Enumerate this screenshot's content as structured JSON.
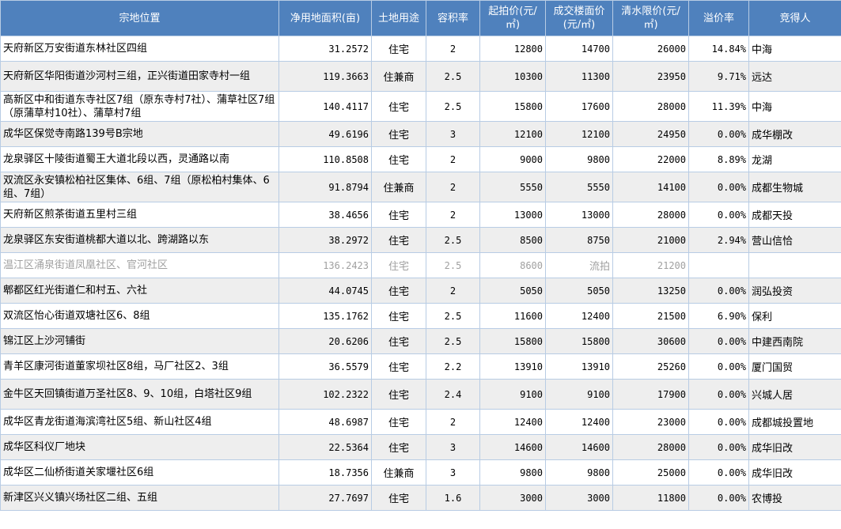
{
  "columns": [
    "宗地位置",
    "净用地面积(亩)",
    "土地用途",
    "容积率",
    "起拍价(元/㎡)",
    "成交楼面价(元/㎡)",
    "清水限价(元/㎡)",
    "溢价率",
    "竞得人"
  ],
  "rows": [
    {
      "location": "天府新区万安街道东林社区四组",
      "area": "31.2572",
      "use": "住宅",
      "far": "2",
      "start": "12800",
      "deal": "14700",
      "limit": "26000",
      "premium": "14.84%",
      "winner": "中海"
    },
    {
      "location": "天府新区华阳街道沙河村三组，正兴街道田家寺村一组",
      "area": "119.3663",
      "use": "住兼商",
      "far": "2.5",
      "start": "10300",
      "deal": "11300",
      "limit": "23950",
      "premium": "9.71%",
      "winner": "远达"
    },
    {
      "location": "高新区中和街道东寺社区7组（原东寺村7社）、蒲草社区7组（原蒲草村10社）、蒲草村7组",
      "area": "140.4117",
      "use": "住宅",
      "far": "2.5",
      "start": "15800",
      "deal": "17600",
      "limit": "28000",
      "premium": "11.39%",
      "winner": "中海"
    },
    {
      "location": "成华区保觉寺南路139号B宗地",
      "area": "49.6196",
      "use": "住宅",
      "far": "3",
      "start": "12100",
      "deal": "12100",
      "limit": "24950",
      "premium": "0.00%",
      "winner": "成华棚改"
    },
    {
      "location": "龙泉驿区十陵街道蜀王大道北段以西，灵通路以南",
      "area": "110.8508",
      "use": "住宅",
      "far": "2",
      "start": "9000",
      "deal": "9800",
      "limit": "22000",
      "premium": "8.89%",
      "winner": "龙湖"
    },
    {
      "location": "双流区永安镇松柏社区集体、6组、7组（原松柏村集体、6组、7组）",
      "area": "91.8794",
      "use": "住兼商",
      "far": "2",
      "start": "5550",
      "deal": "5550",
      "limit": "14100",
      "premium": "0.00%",
      "winner": "成都生物城"
    },
    {
      "location": "天府新区煎茶街道五里村三组",
      "area": "38.4656",
      "use": "住宅",
      "far": "2",
      "start": "13000",
      "deal": "13000",
      "limit": "28000",
      "premium": "0.00%",
      "winner": "成都天投"
    },
    {
      "location": "龙泉驿区东安街道桃都大道以北、跨湖路以东",
      "area": "38.2972",
      "use": "住宅",
      "far": "2.5",
      "start": "8500",
      "deal": "8750",
      "limit": "21000",
      "premium": "2.94%",
      "winner": "营山信恰"
    },
    {
      "location": "温江区涌泉街道凤凰社区、官河社区",
      "area": "136.2423",
      "use": "住宅",
      "far": "2.5",
      "start": "8600",
      "deal": "流拍",
      "limit": "21200",
      "premium": "",
      "winner": ""
    },
    {
      "location": "郫都区红光街道仁和村五、六社",
      "area": "44.0745",
      "use": "住宅",
      "far": "2",
      "start": "5050",
      "deal": "5050",
      "limit": "13250",
      "premium": "0.00%",
      "winner": "润弘投资"
    },
    {
      "location": "双流区怡心街道双塘社区6、8组",
      "area": "135.1762",
      "use": "住宅",
      "far": "2.5",
      "start": "11600",
      "deal": "12400",
      "limit": "21500",
      "premium": "6.90%",
      "winner": "保利"
    },
    {
      "location": "锦江区上沙河铺街",
      "area": "20.6206",
      "use": "住宅",
      "far": "2.5",
      "start": "15800",
      "deal": "15800",
      "limit": "30600",
      "premium": "0.00%",
      "winner": "中建西南院"
    },
    {
      "location": "青羊区康河街道董家坝社区8组，马厂社区2、3组",
      "area": "36.5579",
      "use": "住宅",
      "far": "2.2",
      "start": "13910",
      "deal": "13910",
      "limit": "25260",
      "premium": "0.00%",
      "winner": "厦门国贸"
    },
    {
      "location": "金牛区天回镇街道万圣社区8、9、10组，白塔社区9组",
      "area": "102.2322",
      "use": "住宅",
      "far": "2.4",
      "start": "9100",
      "deal": "9100",
      "limit": "17900",
      "premium": "0.00%",
      "winner": "兴城人居"
    },
    {
      "location": "成华区青龙街道海滨湾社区5组、新山社区4组",
      "area": "48.6987",
      "use": "住宅",
      "far": "2",
      "start": "12400",
      "deal": "12400",
      "limit": "23000",
      "premium": "0.00%",
      "winner": "成都城投置地"
    },
    {
      "location": "成华区科仪厂地块",
      "area": "22.5364",
      "use": "住宅",
      "far": "3",
      "start": "14600",
      "deal": "14600",
      "limit": "28000",
      "premium": "0.00%",
      "winner": "成华旧改"
    },
    {
      "location": "成华区二仙桥街道关家堰社区6组",
      "area": "18.7356",
      "use": "住兼商",
      "far": "3",
      "start": "9800",
      "deal": "9800",
      "limit": "25000",
      "premium": "0.00%",
      "winner": "成华旧改"
    },
    {
      "location": "新津区兴义镇兴场社区二组、五组",
      "area": "27.7697",
      "use": "住宅",
      "far": "1.6",
      "start": "3000",
      "deal": "3000",
      "limit": "11800",
      "premium": "0.00%",
      "winner": "农博投"
    }
  ]
}
